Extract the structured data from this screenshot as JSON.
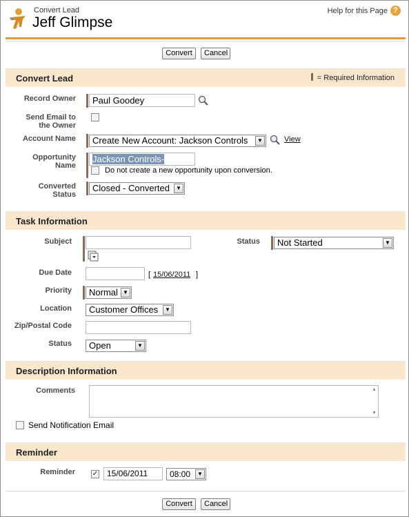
{
  "header": {
    "subtitle": "Convert Lead",
    "title": "Jeff Glimpse",
    "help_label": "Help for this Page",
    "help_icon": "question-icon"
  },
  "buttons": {
    "convert": "Convert",
    "cancel": "Cancel"
  },
  "convert_lead": {
    "section_title": "Convert Lead",
    "required_legend": "= Required Information",
    "record_owner_label": "Record Owner",
    "record_owner_value": "Paul Goodey",
    "send_email_label_1": "Send Email to",
    "send_email_label_2": "the Owner",
    "account_name_label": "Account Name",
    "account_name_value": "Create New Account: Jackson Controls",
    "view_link": "View",
    "opportunity_label_1": "Opportunity",
    "opportunity_label_2": "Name",
    "opportunity_value": "Jackson Controls-",
    "no_opportunity_label": "Do not create a new opportunity upon conversion.",
    "converted_status_label_1": "Converted",
    "converted_status_label_2": "Status",
    "converted_status_value": "Closed - Converted"
  },
  "task": {
    "section_title": "Task Information",
    "subject_label": "Subject",
    "subject_value": "",
    "status_label": "Status",
    "status_value": "Not Started",
    "due_date_label": "Due Date",
    "due_date_value": "",
    "due_date_link": "15/06/2011",
    "bracket_open": "[",
    "bracket_close": "]",
    "priority_label": "Priority",
    "priority_value": "Normal",
    "location_label": "Location",
    "location_value": "Customer Offices",
    "zip_label": "Zip/Postal Code",
    "zip_value": "",
    "task_status_label": "Status",
    "task_status_value": "Open"
  },
  "description": {
    "section_title": "Description Information",
    "comments_label": "Comments",
    "comments_value": "",
    "send_notification_label": "Send Notification Email"
  },
  "reminder": {
    "section_title": "Reminder",
    "reminder_label": "Reminder",
    "reminder_checked": true,
    "reminder_check_glyph": "✓",
    "date_value": "15/06/2011",
    "time_value": "08:00"
  },
  "colors": {
    "accent": "#e39b3a",
    "section_bg": "#fbe7cd",
    "required": "#8c6d5a"
  }
}
